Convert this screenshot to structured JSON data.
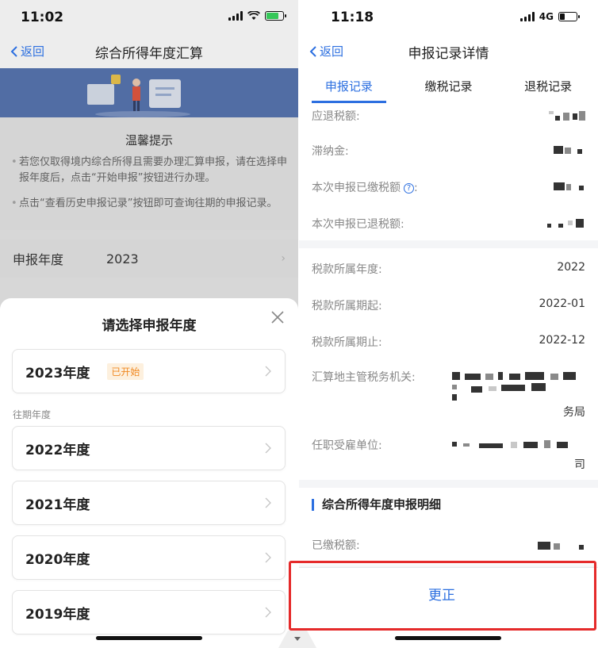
{
  "left": {
    "status": {
      "time": "11:02"
    },
    "nav": {
      "back": "返回",
      "title": "综合所得年度汇算"
    },
    "tips": {
      "title": "温馨提示",
      "items": [
        "若您仅取得境内综合所得且需要办理汇算申报，请在选择申报年度后，点击“开始申报”按钮进行办理。",
        "点击“查看历史申报记录”按钮即可查询往期的申报记录。"
      ]
    },
    "year_row": {
      "label": "申报年度",
      "value": "2023"
    },
    "sheet": {
      "title": "请选择申报年度",
      "current": {
        "year": "2023年度",
        "badge": "已开始"
      },
      "past_label": "往期年度",
      "past_years": [
        "2022年度",
        "2021年度",
        "2020年度",
        "2019年度"
      ]
    }
  },
  "right": {
    "status": {
      "time": "11:18",
      "network": "4G"
    },
    "nav": {
      "back": "返回",
      "title": "申报记录详情"
    },
    "tabs": [
      "申报记录",
      "缴税记录",
      "退税记录"
    ],
    "summary": {
      "refund_due": "应退税额:",
      "late_fee": "滞纳金:",
      "paid_this": "本次申报已缴税额",
      "refunded_this": "本次申报已退税额:"
    },
    "period": {
      "year_label": "税款所属年度:",
      "year_value": "2022",
      "start_label": "税款所属期起:",
      "start_value": "2022-01",
      "end_label": "税款所属期止:",
      "end_value": "2022-12",
      "authority_label": "汇算地主管税务机关:",
      "authority_tail": "务局",
      "employer_label": "任职受雇单位:",
      "employer_tail": "司"
    },
    "detail": {
      "title": "综合所得年度申报明细",
      "paid_label": "已缴税额:"
    },
    "action": {
      "label": "更正"
    }
  },
  "colors": {
    "accent": "#2c6fe0",
    "highlight": "#e52a2a",
    "badge": "#f08a24"
  }
}
